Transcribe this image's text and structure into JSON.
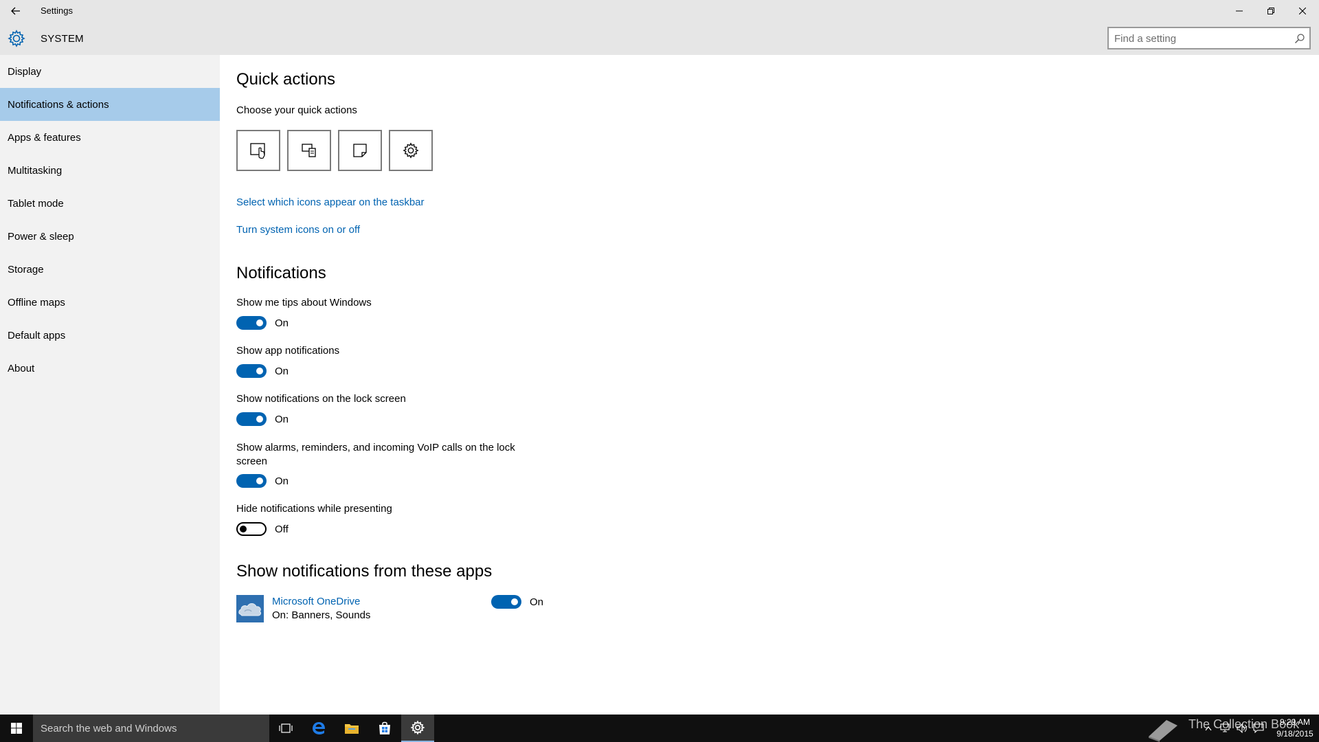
{
  "window": {
    "title": "Settings"
  },
  "header": {
    "title": "SYSTEM",
    "search_placeholder": "Find a setting"
  },
  "sidebar": {
    "items": [
      {
        "label": "Display"
      },
      {
        "label": "Notifications & actions"
      },
      {
        "label": "Apps & features"
      },
      {
        "label": "Multitasking"
      },
      {
        "label": "Tablet mode"
      },
      {
        "label": "Power & sleep"
      },
      {
        "label": "Storage"
      },
      {
        "label": "Offline maps"
      },
      {
        "label": "Default apps"
      },
      {
        "label": "About"
      }
    ],
    "selected_index": 1
  },
  "quick_actions": {
    "heading": "Quick actions",
    "subheading": "Choose your quick actions",
    "buttons": [
      "tablet-mode-icon",
      "project-icon",
      "note-icon",
      "all-settings-icon"
    ],
    "link_taskbar_icons": "Select which icons appear on the taskbar",
    "link_system_icons": "Turn system icons on or off"
  },
  "notifications": {
    "heading": "Notifications",
    "settings": [
      {
        "label": "Show me tips about Windows",
        "state": "On",
        "on": true
      },
      {
        "label": "Show app notifications",
        "state": "On",
        "on": true
      },
      {
        "label": "Show notifications on the lock screen",
        "state": "On",
        "on": true
      },
      {
        "label": "Show alarms, reminders, and incoming VoIP calls on the lock screen",
        "state": "On",
        "on": true
      },
      {
        "label": "Hide notifications while presenting",
        "state": "Off",
        "on": false
      }
    ]
  },
  "apps": {
    "heading": "Show notifications from these apps",
    "items": [
      {
        "name": "Microsoft OneDrive",
        "detail": "On: Banners, Sounds",
        "state": "On",
        "on": true
      }
    ]
  },
  "taskbar": {
    "search_placeholder": "Search the web and Windows",
    "watermark": "The Collection Book",
    "clock_time": "9:29 AM",
    "clock_date": "9/18/2015"
  },
  "colors": {
    "accent": "#0063b1",
    "selected_nav": "#a6cbea",
    "chrome": "#e6e6e6",
    "sidebar": "#f2f2f2",
    "taskbar": "#101010"
  }
}
